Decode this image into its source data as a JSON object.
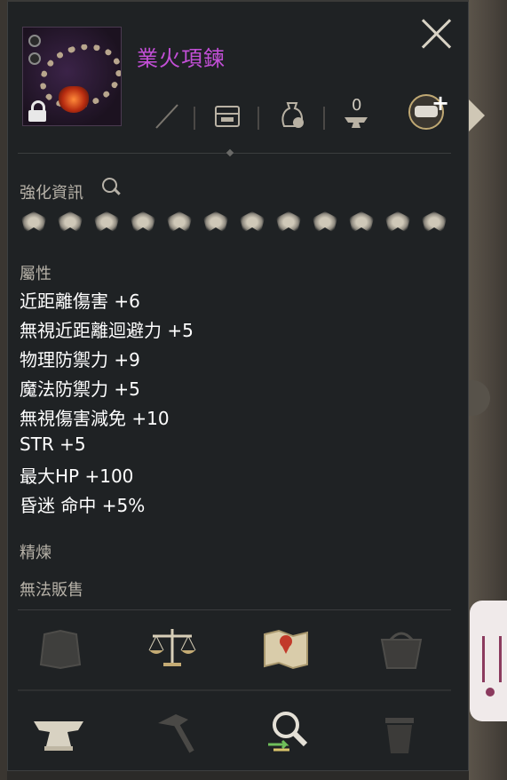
{
  "item": {
    "name": "業火項鍊",
    "name_color": "#c24fd6"
  },
  "toolbar": {
    "icons": [
      "sword-icon",
      "chest-icon",
      "bag-icon",
      "anvil-count-icon"
    ],
    "anvil_count": "0",
    "chat_button": "chat-add-icon"
  },
  "enhance": {
    "label": "強化資訊",
    "emblem_icons": [
      "dragon-crest-icon",
      "pillar-crest-icon",
      "beast-crest-icon",
      "claw-crest-icon",
      "wing-crest-icon",
      "blade-crest-icon",
      "cross-swords-crest-icon",
      "flower-crest-icon",
      "wolf-crest-icon",
      "eagle-crest-icon",
      "eye-crest-icon",
      "feather-crest-icon"
    ]
  },
  "attributes": {
    "label": "屬性",
    "stats": [
      "近距離傷害 +6",
      "無視近距離迴避力 +5",
      "物理防禦力 +9",
      "魔法防禦力 +5",
      "無視傷害減免 +10",
      "STR +5",
      "最大HP +100",
      "昏迷 命中 +5%"
    ]
  },
  "refine_label": "精煉",
  "unsellable_label": "無法販售",
  "actions": {
    "row1": [
      "storage-icon",
      "scale-icon",
      "map-icon",
      "basket-icon"
    ],
    "row2": [
      "anvil-icon",
      "hammer-icon",
      "search-exchange-icon",
      "trash-icon"
    ]
  },
  "colors": {
    "panel": "#1f2224",
    "label": "#b7b2a8",
    "stat": "#ffffff"
  }
}
